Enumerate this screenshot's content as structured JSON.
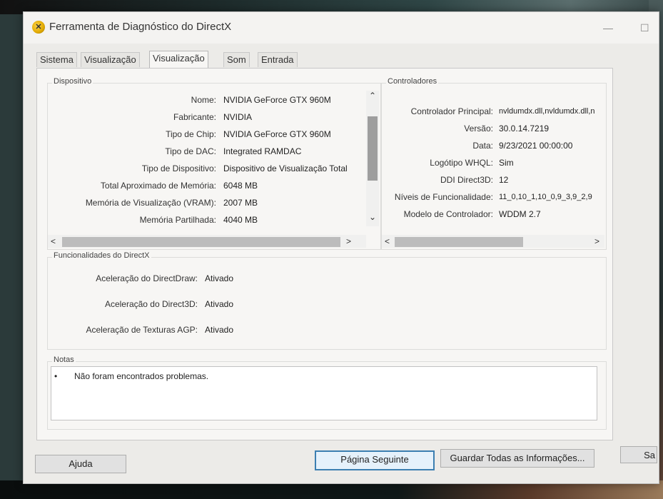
{
  "window": {
    "title": "Ferramenta de Diagnóstico do DirectX"
  },
  "tabs": [
    {
      "label": "Sistema"
    },
    {
      "label": "Visualização 1"
    },
    {
      "label": "Visualização 2"
    },
    {
      "label": "Som"
    },
    {
      "label": "Entrada"
    }
  ],
  "device": {
    "legend": "Dispositivo",
    "rows": [
      {
        "label": "Nome:",
        "value": "NVIDIA GeForce GTX 960M"
      },
      {
        "label": "Fabricante:",
        "value": "NVIDIA"
      },
      {
        "label": "Tipo de Chip:",
        "value": "NVIDIA GeForce GTX 960M"
      },
      {
        "label": "Tipo de DAC:",
        "value": "Integrated RAMDAC"
      },
      {
        "label": "Tipo de Dispositivo:",
        "value": "Dispositivo de Visualização Total"
      },
      {
        "label": "Total Aproximado de Memória:",
        "value": "6048 MB"
      },
      {
        "label": "Memória de Visualização (VRAM):",
        "value": "2007 MB"
      },
      {
        "label": "Memória Partilhada:",
        "value": "4040 MB"
      }
    ]
  },
  "drivers": {
    "legend": "Controladores",
    "rows": [
      {
        "label": "Controlador Principal:",
        "value": "nvldumdx.dll,nvldumdx.dll,n"
      },
      {
        "label": "Versão:",
        "value": "30.0.14.7219"
      },
      {
        "label": "Data:",
        "value": "9/23/2021 00:00:00"
      },
      {
        "label": "Logótipo WHQL:",
        "value": "Sim"
      },
      {
        "label": "DDI Direct3D:",
        "value": "12"
      },
      {
        "label": "Níveis de Funcionalidade:",
        "value": "11_0,10_1,10_0,9_3,9_2,9"
      },
      {
        "label": "Modelo de Controlador:",
        "value": "WDDM 2.7"
      }
    ]
  },
  "features": {
    "legend": "Funcionalidades do DirectX",
    "rows": [
      {
        "label": "Aceleração do DirectDraw:",
        "value": "Ativado"
      },
      {
        "label": "Aceleração do Direct3D:",
        "value": "Ativado"
      },
      {
        "label": "Aceleração de Texturas AGP:",
        "value": "Ativado"
      }
    ]
  },
  "notes": {
    "legend": "Notas",
    "bullet": "•",
    "text": "Não foram encontrados problemas."
  },
  "buttons": {
    "help": "Ajuda",
    "next": "Página Seguinte",
    "save_all": "Guardar Todas as Informações...",
    "exit": "Sa"
  },
  "icons": {
    "scroll_up": "⌃",
    "scroll_down": "⌄",
    "scroll_left": "<",
    "scroll_right": ">"
  },
  "colors": {
    "default_button_border": "#3c7fb1",
    "window_bg": "#ecebe8"
  }
}
